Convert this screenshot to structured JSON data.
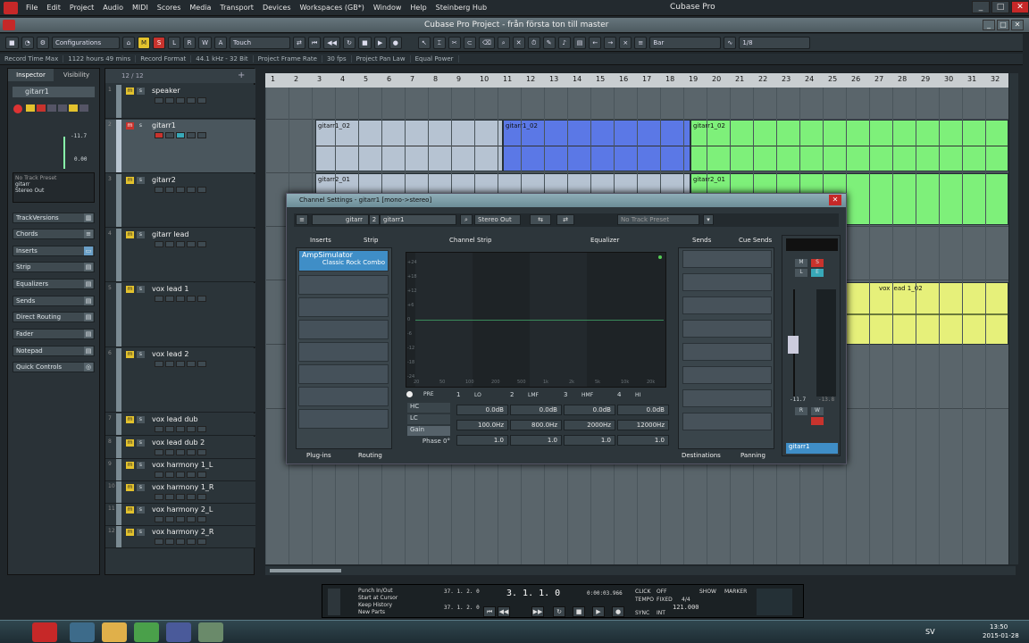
{
  "menubar": {
    "items": [
      "File",
      "Edit",
      "Project",
      "Audio",
      "MIDI",
      "Scores",
      "Media",
      "Transport",
      "Devices",
      "Workspaces (GB*)",
      "Window",
      "Help",
      "Steinberg Hub"
    ],
    "title": "Cubase Pro"
  },
  "project": {
    "title": "Cubase Pro Project - från första ton till master"
  },
  "toolbar": {
    "configurations": "Configurations",
    "mode": "Touch",
    "snap": "Bar",
    "quant": "1/8",
    "msrw": [
      "M",
      "S",
      "L",
      "R",
      "W",
      "A"
    ]
  },
  "infoline": {
    "record_time_label": "Record Time Max",
    "record_time": "1122 hours 49 mins",
    "record_format_label": "Record Format",
    "record_format": "44.1 kHz - 32 Bit",
    "frame_rate_label": "Project Frame Rate",
    "frame_rate": "30 fps",
    "pan_law_label": "Project Pan Law",
    "pan_law": "Equal Power"
  },
  "inspector": {
    "tabs": [
      "Inspector",
      "Visibility"
    ],
    "track_name": "gitarr1",
    "volume": "-11.7",
    "pan": "0.00",
    "no_preset": "No Track Preset",
    "input": "gitarr",
    "output": "Stereo Out",
    "sections": [
      "TrackVersions",
      "Chords",
      "Inserts",
      "Strip",
      "Equalizers",
      "Sends",
      "Direct Routing",
      "Fader",
      "Notepad",
      "Quick Controls"
    ]
  },
  "tracklist": {
    "counter": "12 / 12",
    "tracks": [
      {
        "num": "1",
        "name": "speaker"
      },
      {
        "num": "2",
        "name": "gitarr1"
      },
      {
        "num": "3",
        "name": "gitarr2"
      },
      {
        "num": "4",
        "name": "gitarr lead"
      },
      {
        "num": "5",
        "name": "vox lead 1"
      },
      {
        "num": "6",
        "name": "vox lead 2"
      },
      {
        "num": "7",
        "name": "vox lead dub"
      },
      {
        "num": "8",
        "name": "vox lead dub 2"
      },
      {
        "num": "9",
        "name": "vox harmony 1_L"
      },
      {
        "num": "10",
        "name": "vox harmony 1_R"
      },
      {
        "num": "11",
        "name": "vox harmony 2_L"
      },
      {
        "num": "12",
        "name": "vox harmony 2_R"
      }
    ]
  },
  "ruler": {
    "bars": [
      "1",
      "2",
      "3",
      "4",
      "5",
      "6",
      "7",
      "8",
      "9",
      "10",
      "11",
      "12",
      "13",
      "14",
      "15",
      "16",
      "17",
      "18",
      "19",
      "20",
      "21",
      "22",
      "23",
      "24",
      "25",
      "26",
      "27",
      "28",
      "29",
      "30",
      "31",
      "32"
    ]
  },
  "events": {
    "gitarr1": "gitarr1_02",
    "gitarr2_a": "gitarr2_01",
    "gitarr2_b": "gitarr2_01",
    "vox": "vox lead 1_02"
  },
  "channel": {
    "title": "Channel Settings - gitarr1 [mono->stereo]",
    "input": "gitarr",
    "index": "2",
    "name": "gitarr1",
    "output": "Stereo Out",
    "preset": "No Track Preset",
    "tabs": {
      "inserts": "Inserts",
      "strip": "Strip",
      "channel_strip": "Channel Strip",
      "equalizer": "Equalizer",
      "sends": "Sends",
      "cue_sends": "Cue Sends"
    },
    "insert_plugin": "AmpSimulator",
    "insert_preset": "Classic Rock Combo",
    "bottom_tabs": {
      "plugins": "Plug-ins",
      "routing": "Routing",
      "destinations": "Destinations",
      "panning": "Panning"
    },
    "eq": {
      "db_labels": [
        "+24",
        "+18",
        "+12",
        "+6",
        "0",
        "-6",
        "-12",
        "-18",
        "-24"
      ],
      "freq_labels": [
        "20",
        "50",
        "100",
        "200",
        "500",
        "1k",
        "2k",
        "5k",
        "10k",
        "20k"
      ],
      "pre": "PRE",
      "hc": "HC",
      "lc": "LC",
      "gain": "Gain",
      "phase": "Phase 0°",
      "bands": [
        {
          "n": "1",
          "type": "LO",
          "gain": "0.0dB",
          "freq": "100.0Hz",
          "q": "1.0"
        },
        {
          "n": "2",
          "type": "LMF",
          "gain": "0.0dB",
          "freq": "800.0Hz",
          "q": "1.0"
        },
        {
          "n": "3",
          "type": "HMF",
          "gain": "0.0dB",
          "freq": "2000Hz",
          "q": "1.0"
        },
        {
          "n": "4",
          "type": "HI",
          "gain": "0.0dB",
          "freq": "12000Hz",
          "q": "1.0"
        }
      ]
    },
    "fader": {
      "value": "-11.7",
      "peak": "-13.8",
      "channel_name": "gitarr1",
      "m": "M",
      "s": "S",
      "l": "L",
      "e": "E",
      "r": "R",
      "w": "W"
    }
  },
  "transport": {
    "punch": "Punch In/Out",
    "start_cursor": "Start at Cursor",
    "keep_history": "Keep History",
    "new_parts": "New Parts",
    "left_locator": "37. 1. 2. 0",
    "right_locator": "37. 1. 2. 0",
    "position": "3. 1. 1.  0",
    "time": "0:00:03.966",
    "click": "CLICK",
    "click_state": "OFF",
    "tempo": "TEMPO",
    "tempo_mode": "FIXED",
    "signature": "4/4",
    "tempo_value": "121.000",
    "sync": "SYNC",
    "sync_state": "INT",
    "show": "SHOW",
    "marker": "MARKER"
  },
  "taskbar": {
    "lang": "SV",
    "time": "13:50",
    "date": "2015-01-28"
  },
  "colors": {
    "gitarr1": "#aeb9c9",
    "selected": "#5b78e6",
    "green": "#7ef07a",
    "vox": "#e6f07a",
    "accent": "#c62828"
  }
}
